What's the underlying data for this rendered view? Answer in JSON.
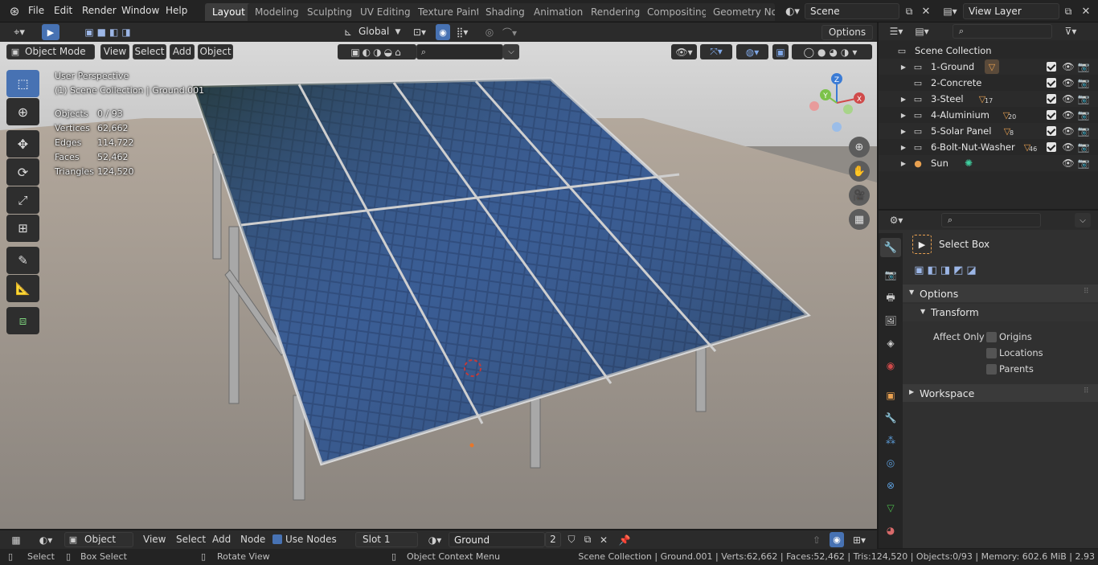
{
  "menu": [
    "File",
    "Edit",
    "Render",
    "Window",
    "Help"
  ],
  "workspaces": [
    "Layout",
    "Modeling",
    "Sculpting",
    "UV Editing",
    "Texture Paint",
    "Shading",
    "Animation",
    "Rendering",
    "Compositing",
    "Geometry Nod"
  ],
  "scene_name": "Scene",
  "view_layer": "View Layer",
  "header": {
    "orientation": "Global",
    "options": "Options",
    "mode": "Object Mode",
    "view": "View",
    "select": "Select",
    "add": "Add",
    "object": "Object"
  },
  "overlay": {
    "perspective": "User Perspective",
    "collection": "(1) Scene Collection | Ground.001",
    "stats": [
      {
        "label": "Objects",
        "value": "0 / 93"
      },
      {
        "label": "Vertices",
        "value": "62,662"
      },
      {
        "label": "Edges",
        "value": "114,722"
      },
      {
        "label": "Faces",
        "value": "52,462"
      },
      {
        "label": "Triangles",
        "value": "124,520"
      }
    ]
  },
  "gizmo": {
    "x": "X",
    "y": "Y",
    "z": "Z"
  },
  "outliner": {
    "root": "Scene Collection",
    "items": [
      {
        "name": "1-Ground",
        "badge": ""
      },
      {
        "name": "2-Concrete",
        "badge": ""
      },
      {
        "name": "3-Steel",
        "badge": "17"
      },
      {
        "name": "4-Aluminium",
        "badge": "20"
      },
      {
        "name": "5-Solar Panel",
        "badge": "8"
      },
      {
        "name": "6-Bolt-Nut-Washer",
        "badge": "46"
      },
      {
        "name": "Sun",
        "badge": ""
      }
    ]
  },
  "props": {
    "tool_name": "Select Box",
    "options": "Options",
    "transform": "Transform",
    "affect_only": "Affect Only",
    "checks": [
      "Origins",
      "Locations",
      "Parents"
    ],
    "workspace": "Workspace"
  },
  "bottom": {
    "object": "Object",
    "view": "View",
    "select": "Select",
    "add": "Add",
    "node": "Node",
    "use_nodes": "Use Nodes",
    "slot": "Slot 1",
    "material": "Ground",
    "users": "2"
  },
  "status": {
    "select": "Select",
    "box_select": "Box Select",
    "rotate_view": "Rotate View",
    "context_menu": "Object Context Menu",
    "info": "Scene Collection | Ground.001 | Verts:62,662 | Faces:52,462 | Tris:124,520 | Objects:0/93 | Memory: 602.6 MiB | 2.93"
  },
  "colors": {
    "accent": "#4772b3",
    "panel": "#303030",
    "header": "#232323",
    "viewport_bg": "#8f8b86"
  }
}
